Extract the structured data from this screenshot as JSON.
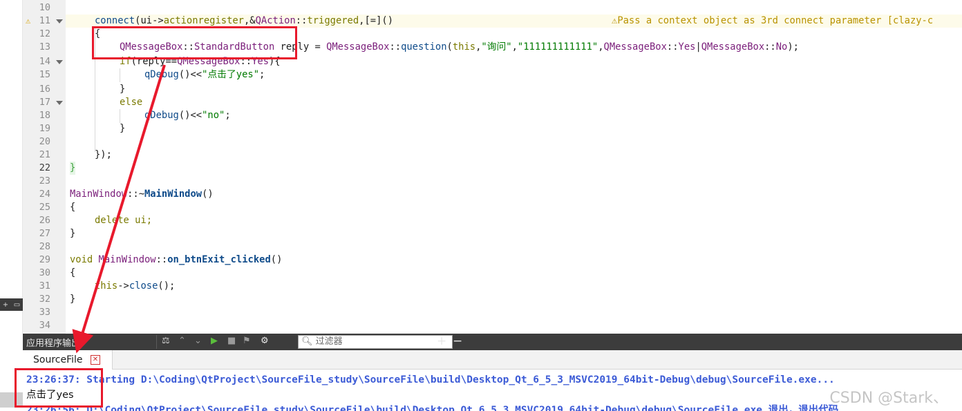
{
  "editor": {
    "lines": [
      {
        "n": "10"
      },
      {
        "n": "11"
      },
      {
        "n": "12"
      },
      {
        "n": "13"
      },
      {
        "n": "14"
      },
      {
        "n": "15"
      },
      {
        "n": "16"
      },
      {
        "n": "17"
      },
      {
        "n": "18"
      },
      {
        "n": "19"
      },
      {
        "n": "20"
      },
      {
        "n": "21"
      },
      {
        "n": "22"
      },
      {
        "n": "23"
      },
      {
        "n": "24"
      },
      {
        "n": "25"
      },
      {
        "n": "26"
      },
      {
        "n": "27"
      },
      {
        "n": "28"
      },
      {
        "n": "29"
      },
      {
        "n": "30"
      },
      {
        "n": "31"
      },
      {
        "n": "32"
      },
      {
        "n": "33"
      },
      {
        "n": "34"
      }
    ],
    "code": {
      "l11_a": "connect",
      "l11_b": "(ui->",
      "l11_c": "actionregister",
      "l11_d": ",&",
      "l11_e": "QAction",
      "l11_f": "::",
      "l11_g": "triggered",
      "l11_h": ",[=]()",
      "l12": "{",
      "l13_a": "QMessageBox",
      "l13_b": "::",
      "l13_c": "StandardButton",
      "l13_d": " reply = ",
      "l13_e": "QMessageBox",
      "l13_f": "::",
      "l13_g": "question",
      "l13_h": "(",
      "l13_i": "this",
      "l13_j": ",",
      "l13_k": "\"询问\"",
      "l13_l": ",",
      "l13_m": "\"111111111111\"",
      "l13_n": ",",
      "l13_o": "QMessageBox",
      "l13_p": "::",
      "l13_q": "Yes",
      "l13_r": "|",
      "l13_s": "QMessageBox",
      "l13_t": "::",
      "l13_u": "No",
      "l13_v": ");",
      "l14_a": "if",
      "l14_b": "(reply==",
      "l14_c": "QMessageBox",
      "l14_d": "::",
      "l14_e": "Yes",
      "l14_f": "){",
      "l15_a": "qDebug",
      "l15_b": "()<<",
      "l15_c": "\"点击了yes\"",
      "l15_d": ";",
      "l16": "}",
      "l17": "else",
      "l18_a": "qDebug",
      "l18_b": "()<<",
      "l18_c": "\"no\"",
      "l18_d": ";",
      "l19": "}",
      "l21": "});",
      "l22": "}",
      "l24_a": "MainWindow",
      "l24_b": "::~",
      "l24_c": "MainWindow",
      "l24_d": "()",
      "l25": "{",
      "l26_a": "delete",
      "l26_b": " ui;",
      "l27": "}",
      "l29_a": "void",
      "l29_b": " ",
      "l29_c": "MainWindow",
      "l29_d": "::",
      "l29_e": "on_btnExit_clicked",
      "l29_f": "()",
      "l30": "{",
      "l31_a": "this",
      "l31_b": "->",
      "l31_c": "close",
      "l31_d": "();",
      "l32": "}"
    },
    "warning": "Pass a context object as 3rd connect parameter [clazy-c"
  },
  "output_panel": {
    "title": "应用程序输出",
    "filter_placeholder": "过滤器",
    "plus": "+",
    "minus": "−"
  },
  "tabs": [
    {
      "label": "SourceFile",
      "close": "✕"
    }
  ],
  "output": {
    "line1": "23:26:37: Starting D:\\Coding\\QtProject\\SourceFile_study\\SourceFile\\build\\Desktop_Qt_6_5_3_MSVC2019_64bit-Debug\\debug\\SourceFile.exe...",
    "line2": "点击了yes",
    "line3": "23:26:56: D:\\Coding\\QtProject\\SourceFile_study\\SourceFile\\build\\Desktop_Qt_6_5_3_MSVC2019_64bit-Debug\\debug\\SourceFile.exe 退出，退出代码"
  },
  "watermark": "CSDN @Stark、",
  "colors": {
    "annotation_red": "#e8192c",
    "output_blue": "#3c5bd6",
    "warning_yellow": "#b99300"
  }
}
